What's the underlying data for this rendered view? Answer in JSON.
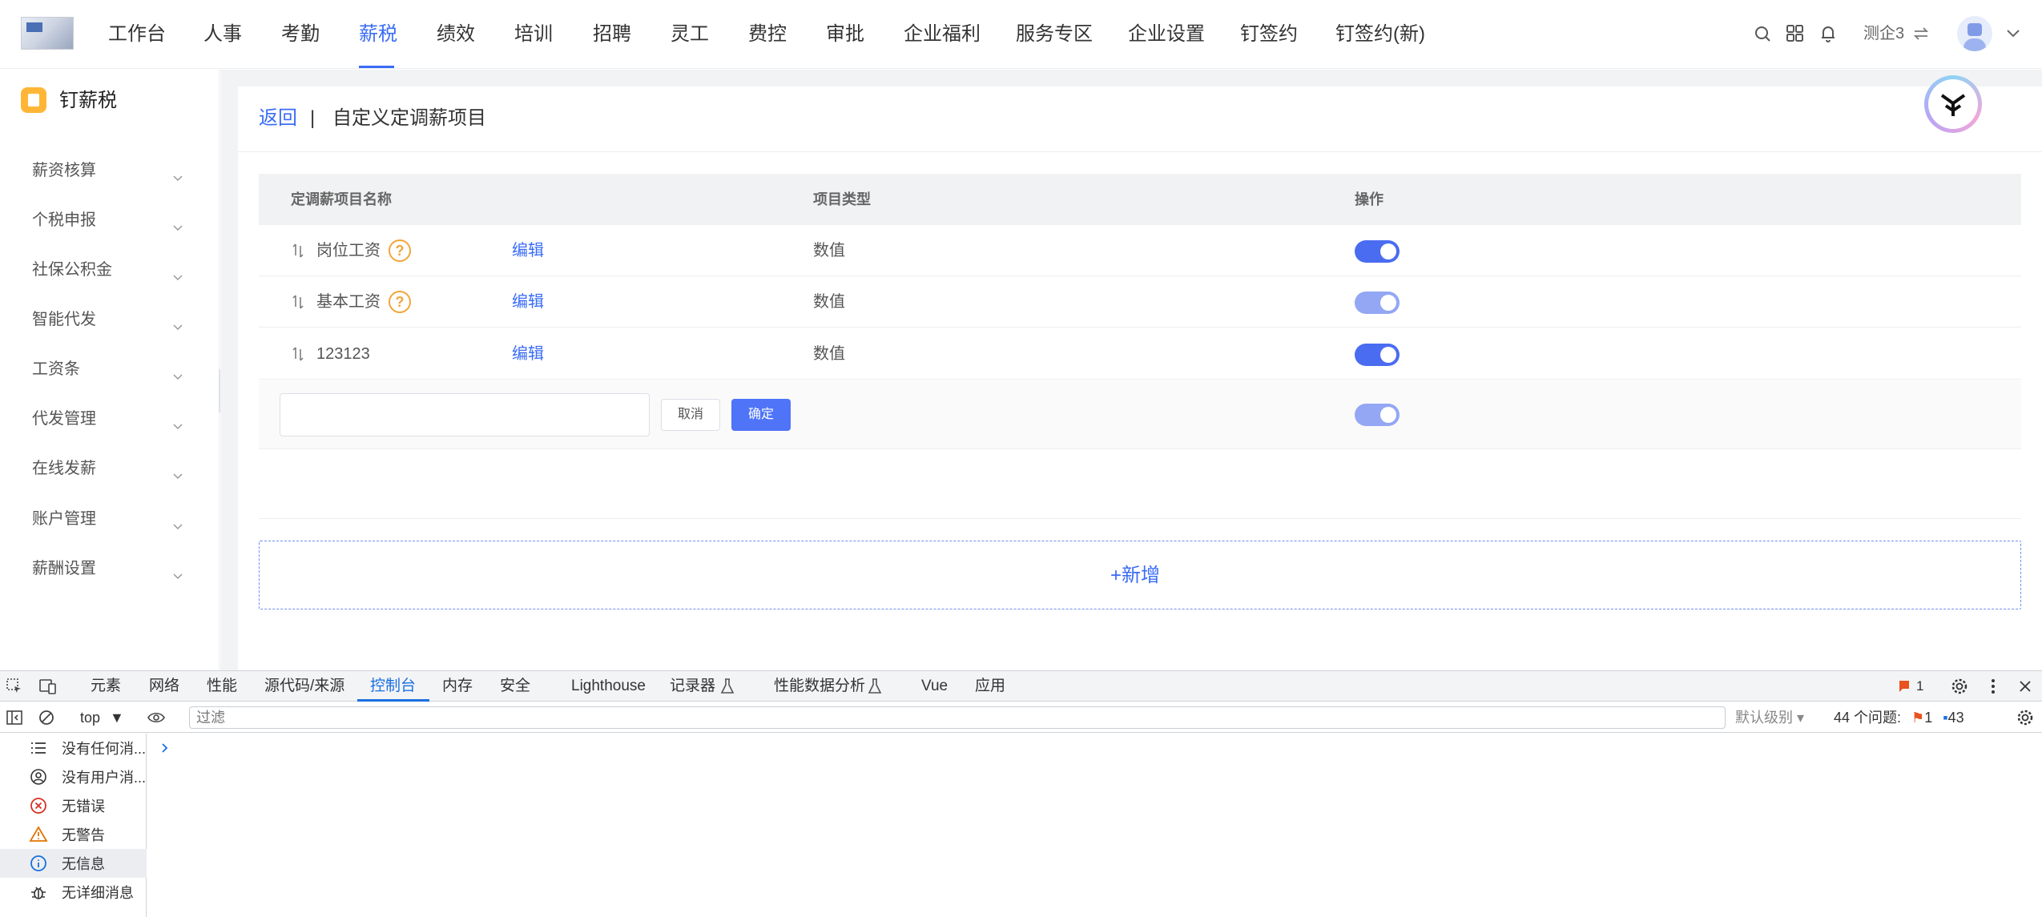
{
  "topnav": {
    "items": [
      "工作台",
      "人事",
      "考勤",
      "薪税",
      "绩效",
      "培训",
      "招聘",
      "灵工",
      "费控",
      "审批",
      "企业福利",
      "服务专区",
      "企业设置",
      "钉签约",
      "钉签约(新)"
    ],
    "active_item": "薪税",
    "tenant_name": "测企3",
    "icons": [
      "search-icon",
      "apps-grid-icon",
      "bell-icon",
      "switch-icon",
      "chevron-down-icon"
    ]
  },
  "sidebar": {
    "brand": "钉薪税",
    "items": [
      "薪资核算",
      "个税申报",
      "社保公积金",
      "智能代发",
      "工资条",
      "代发管理",
      "在线发薪",
      "账户管理",
      "薪酬设置"
    ]
  },
  "page": {
    "back_label": "返回",
    "separator": "|",
    "title": "自定义定调薪项目"
  },
  "table": {
    "columns": [
      "定调薪项目名称",
      "项目类型",
      "操作"
    ],
    "rows": [
      {
        "name": "岗位工资",
        "has_help": true,
        "edit_label": "编辑",
        "type": "数值",
        "enabled": true,
        "dim": false
      },
      {
        "name": "基本工资",
        "has_help": true,
        "edit_label": "编辑",
        "type": "数值",
        "enabled": true,
        "dim": true
      },
      {
        "name": "123123",
        "has_help": false,
        "edit_label": "编辑",
        "type": "数值",
        "enabled": true,
        "dim": false
      }
    ],
    "help_glyph": "?",
    "edit_row": {
      "input_value": "",
      "cancel_label": "取消",
      "confirm_label": "确定"
    },
    "add_label": "新增",
    "add_glyph": "+"
  },
  "devtools": {
    "tabs": [
      "元素",
      "网络",
      "性能",
      "源代码/来源",
      "控制台",
      "内存",
      "安全",
      "Lighthouse",
      "记录器",
      "性能数据分析",
      "Vue",
      "应用"
    ],
    "active_tab": "控制台",
    "error_badge": "1",
    "context": "top",
    "filter_placeholder": "过滤",
    "level": "默认级别",
    "issues_label": "44 个问题:",
    "issues_errors": "1",
    "issues_info": "43",
    "side_items": [
      "没有任何消...",
      "没有用户消...",
      "无错误",
      "无警告",
      "无信息",
      "无详细消息"
    ],
    "selected_side_item": "无信息"
  },
  "colors": {
    "accent": "#3a6cf6",
    "switch_on": "#4a6cf0",
    "switch_dim": "#93a7f4",
    "help": "#f0a63a",
    "devtools_accent": "#1a6fe0"
  }
}
